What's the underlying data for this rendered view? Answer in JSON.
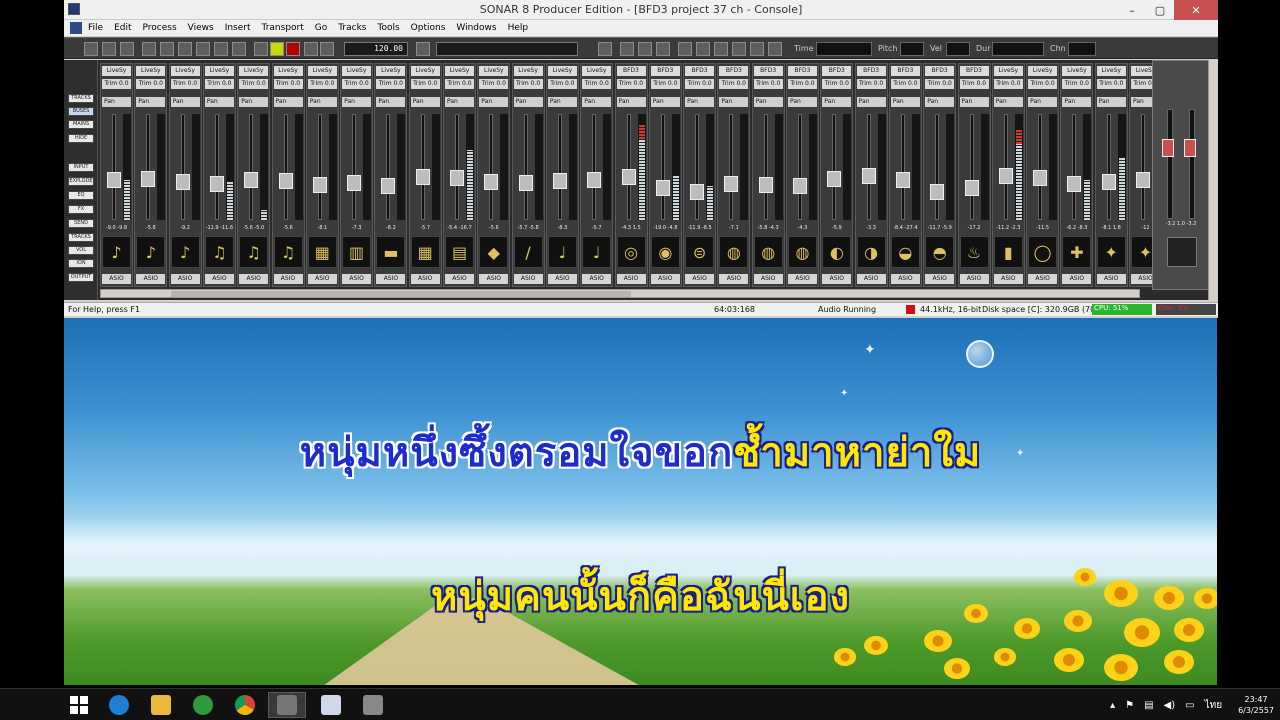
{
  "window": {
    "title": "SONAR 8 Producer Edition - [BFD3 project 37 ch - Console]",
    "controls": {
      "minimize": "–",
      "maximize": "▢",
      "close": "✕"
    }
  },
  "menu": [
    "File",
    "Edit",
    "Process",
    "Views",
    "Insert",
    "Transport",
    "Go",
    "Tracks",
    "Tools",
    "Options",
    "Windows",
    "Help"
  ],
  "toolbar": {
    "tempo": "120.00",
    "labels": {
      "time": "Time",
      "pitch": "Pitch",
      "vel": "Vel",
      "dur": "Dur",
      "chn": "Chn"
    }
  },
  "left_panel": [
    "TRACKS",
    "BUSES",
    "MAINS",
    "HIDE",
    "INPUT",
    "EXPLODE",
    "EQ",
    "FX",
    "SEND",
    "TRACKS",
    "VOL",
    "ION",
    "OUTPUT"
  ],
  "strips": [
    {
      "name": "LiveSy",
      "trim": "Trim 0.0",
      "pan": "Pan",
      "readout": "-9.0 -9.8",
      "instrument": "guitar-icon",
      "asio": "ASIO"
    },
    {
      "name": "LiveSy",
      "trim": "Trim 0.0",
      "pan": "Pan",
      "readout": "-5.8",
      "instrument": "acoustic-guitar-icon",
      "asio": "ASIO"
    },
    {
      "name": "LiveSy",
      "trim": "Trim 0.0",
      "pan": "Pan",
      "readout": "-9.2",
      "instrument": "electric-guitar-icon",
      "asio": "ASIO"
    },
    {
      "name": "LiveSy",
      "trim": "Trim 0.0",
      "pan": "Pan",
      "readout": "-11.9 -11.6",
      "instrument": "violin-icon",
      "asio": "ASIO"
    },
    {
      "name": "LiveSy",
      "trim": "Trim 0.0",
      "pan": "Pan",
      "readout": "-5.6 -5.0",
      "instrument": "strings-icon",
      "asio": "ASIO"
    },
    {
      "name": "LiveSy",
      "trim": "Trim 0.0",
      "pan": "Pan",
      "readout": "-5.6",
      "instrument": "harp-icon",
      "asio": "ASIO"
    },
    {
      "name": "LiveSy",
      "trim": "Trim 0.0",
      "pan": "Pan",
      "readout": "-8.1",
      "instrument": "piano-icon",
      "asio": "ASIO"
    },
    {
      "name": "LiveSy",
      "trim": "Trim 0.0",
      "pan": "Pan",
      "readout": "-7.3",
      "instrument": "accordion-icon",
      "asio": "ASIO"
    },
    {
      "name": "LiveSy",
      "trim": "Trim 0.0",
      "pan": "Pan",
      "readout": "-8.2",
      "instrument": "keyboard-icon",
      "asio": "ASIO"
    },
    {
      "name": "LiveSy",
      "trim": "Trim 0.0",
      "pan": "Pan",
      "readout": "-5.7",
      "instrument": "organ-icon",
      "asio": "ASIO"
    },
    {
      "name": "LiveSy",
      "trim": "Trim 0.0",
      "pan": "Pan",
      "readout": "-5.4 -16.7",
      "instrument": "synth-icon",
      "asio": "ASIO"
    },
    {
      "name": "LiveSy",
      "trim": "Trim 0.0",
      "pan": "Pan",
      "readout": "-5.6",
      "instrument": "keytar-icon",
      "asio": "ASIO"
    },
    {
      "name": "LiveSy",
      "trim": "Trim 0.0",
      "pan": "Pan",
      "readout": "-5.7 -5.8",
      "instrument": "clarinet-icon",
      "asio": "ASIO"
    },
    {
      "name": "LiveSy",
      "trim": "Trim 0.0",
      "pan": "Pan",
      "readout": "-8.3",
      "instrument": "trumpet-icon",
      "asio": "ASIO"
    },
    {
      "name": "LiveSy",
      "trim": "Trim 0.0",
      "pan": "Pan",
      "readout": "-5.7",
      "instrument": "saxophone-icon",
      "asio": "ASIO"
    },
    {
      "name": "BFD3",
      "trim": "Trim 0.0",
      "pan": "Pan",
      "readout": "-4.3 1.5",
      "instrument": "kick-drum-icon",
      "asio": "ASIO"
    },
    {
      "name": "BFD3",
      "trim": "Trim 0.0",
      "pan": "Pan",
      "readout": "-19.0 -4.8",
      "instrument": "snare-icon",
      "asio": "ASIO"
    },
    {
      "name": "BFD3",
      "trim": "Trim 0.0",
      "pan": "Pan",
      "readout": "-11.9 -8.5",
      "instrument": "hihat-icon",
      "asio": "ASIO"
    },
    {
      "name": "BFD3",
      "trim": "Trim 0.0",
      "pan": "Pan",
      "readout": "-7.1",
      "instrument": "tom-icon",
      "asio": "ASIO"
    },
    {
      "name": "BFD3",
      "trim": "Trim 0.0",
      "pan": "Pan",
      "readout": "-5.8 -4.3",
      "instrument": "tom-icon",
      "asio": "ASIO"
    },
    {
      "name": "BFD3",
      "trim": "Trim 0.0",
      "pan": "Pan",
      "readout": "-4.3",
      "instrument": "floor-tom-icon",
      "asio": "ASIO"
    },
    {
      "name": "BFD3",
      "trim": "Trim 0.0",
      "pan": "Pan",
      "readout": "-5.9",
      "instrument": "cymbal-icon",
      "asio": "ASIO"
    },
    {
      "name": "BFD3",
      "trim": "Trim 0.0",
      "pan": "Pan",
      "readout": "-3.3",
      "instrument": "crash-icon",
      "asio": "ASIO"
    },
    {
      "name": "BFD3",
      "trim": "Trim 0.0",
      "pan": "Pan",
      "readout": "-8.4 -27.4",
      "instrument": "ride-icon",
      "asio": "ASIO"
    },
    {
      "name": "BFD3",
      "trim": "Trim 0.0",
      "pan": "Pan",
      "readout": "-11.7 -5.9",
      "instrument": "splash-icon",
      "asio": "ASIO"
    },
    {
      "name": "BFD3",
      "trim": "Trim 0.0",
      "pan": "Pan",
      "readout": "-17.2",
      "instrument": "room-mic-icon",
      "asio": "ASIO"
    },
    {
      "name": "LiveSy",
      "trim": "Trim 0.0",
      "pan": "Pan",
      "readout": "-11.2 -2.3",
      "instrument": "conga-icon",
      "asio": "ASIO"
    },
    {
      "name": "LiveSy",
      "trim": "Trim 0.0",
      "pan": "Pan",
      "readout": "-11.5",
      "instrument": "tambourine-icon",
      "asio": "ASIO"
    },
    {
      "name": "LiveSy",
      "trim": "Trim 0.0",
      "pan": "Pan",
      "readout": "-6.2 -8.3",
      "instrument": "shaker-icon",
      "asio": "ASIO"
    },
    {
      "name": "LiveSy",
      "trim": "Trim 0.0",
      "pan": "Pan",
      "readout": "-8.1 1.8",
      "instrument": "percussion-icon",
      "asio": "ASIO"
    },
    {
      "name": "LiveSy",
      "trim": "Trim 0.0",
      "pan": "Pan",
      "readout": "-12",
      "instrument": "percussion-icon",
      "asio": "ASIO"
    }
  ],
  "master": {
    "readout": "-3.2 1.0 -3.2"
  },
  "status": {
    "help": "For Help, press F1",
    "position": "64:03:168",
    "engine": "Audio Running",
    "format": "44.1kHz, 16-bit",
    "disk": "Disk space [C]: 320.9GB (70%)",
    "cpu": "CPU: 51%",
    "disk_meter": "Disk: 0%"
  },
  "lyrics": {
    "line1_sung": "หนุ่มหนึ่งซึ้งตรอมใจขอก",
    "line1_unsung": "ช้ำมาหาย่าใม",
    "line2": "หนุ่มคนนั้นก็คือฉันนี่เอง"
  },
  "taskbar": {
    "apps": [
      "windows-start-icon",
      "internet-explorer-icon",
      "file-explorer-icon",
      "globe-icon",
      "chrome-icon",
      "media-icon",
      "notepad-icon",
      "tool-icon"
    ],
    "tray_lang": "ไทย",
    "time": "23:47",
    "date": "6/3/2557"
  },
  "colors": {
    "sung": "#1f2ccc",
    "unsung": "#ffe800",
    "cpu": "#2bb52b"
  }
}
